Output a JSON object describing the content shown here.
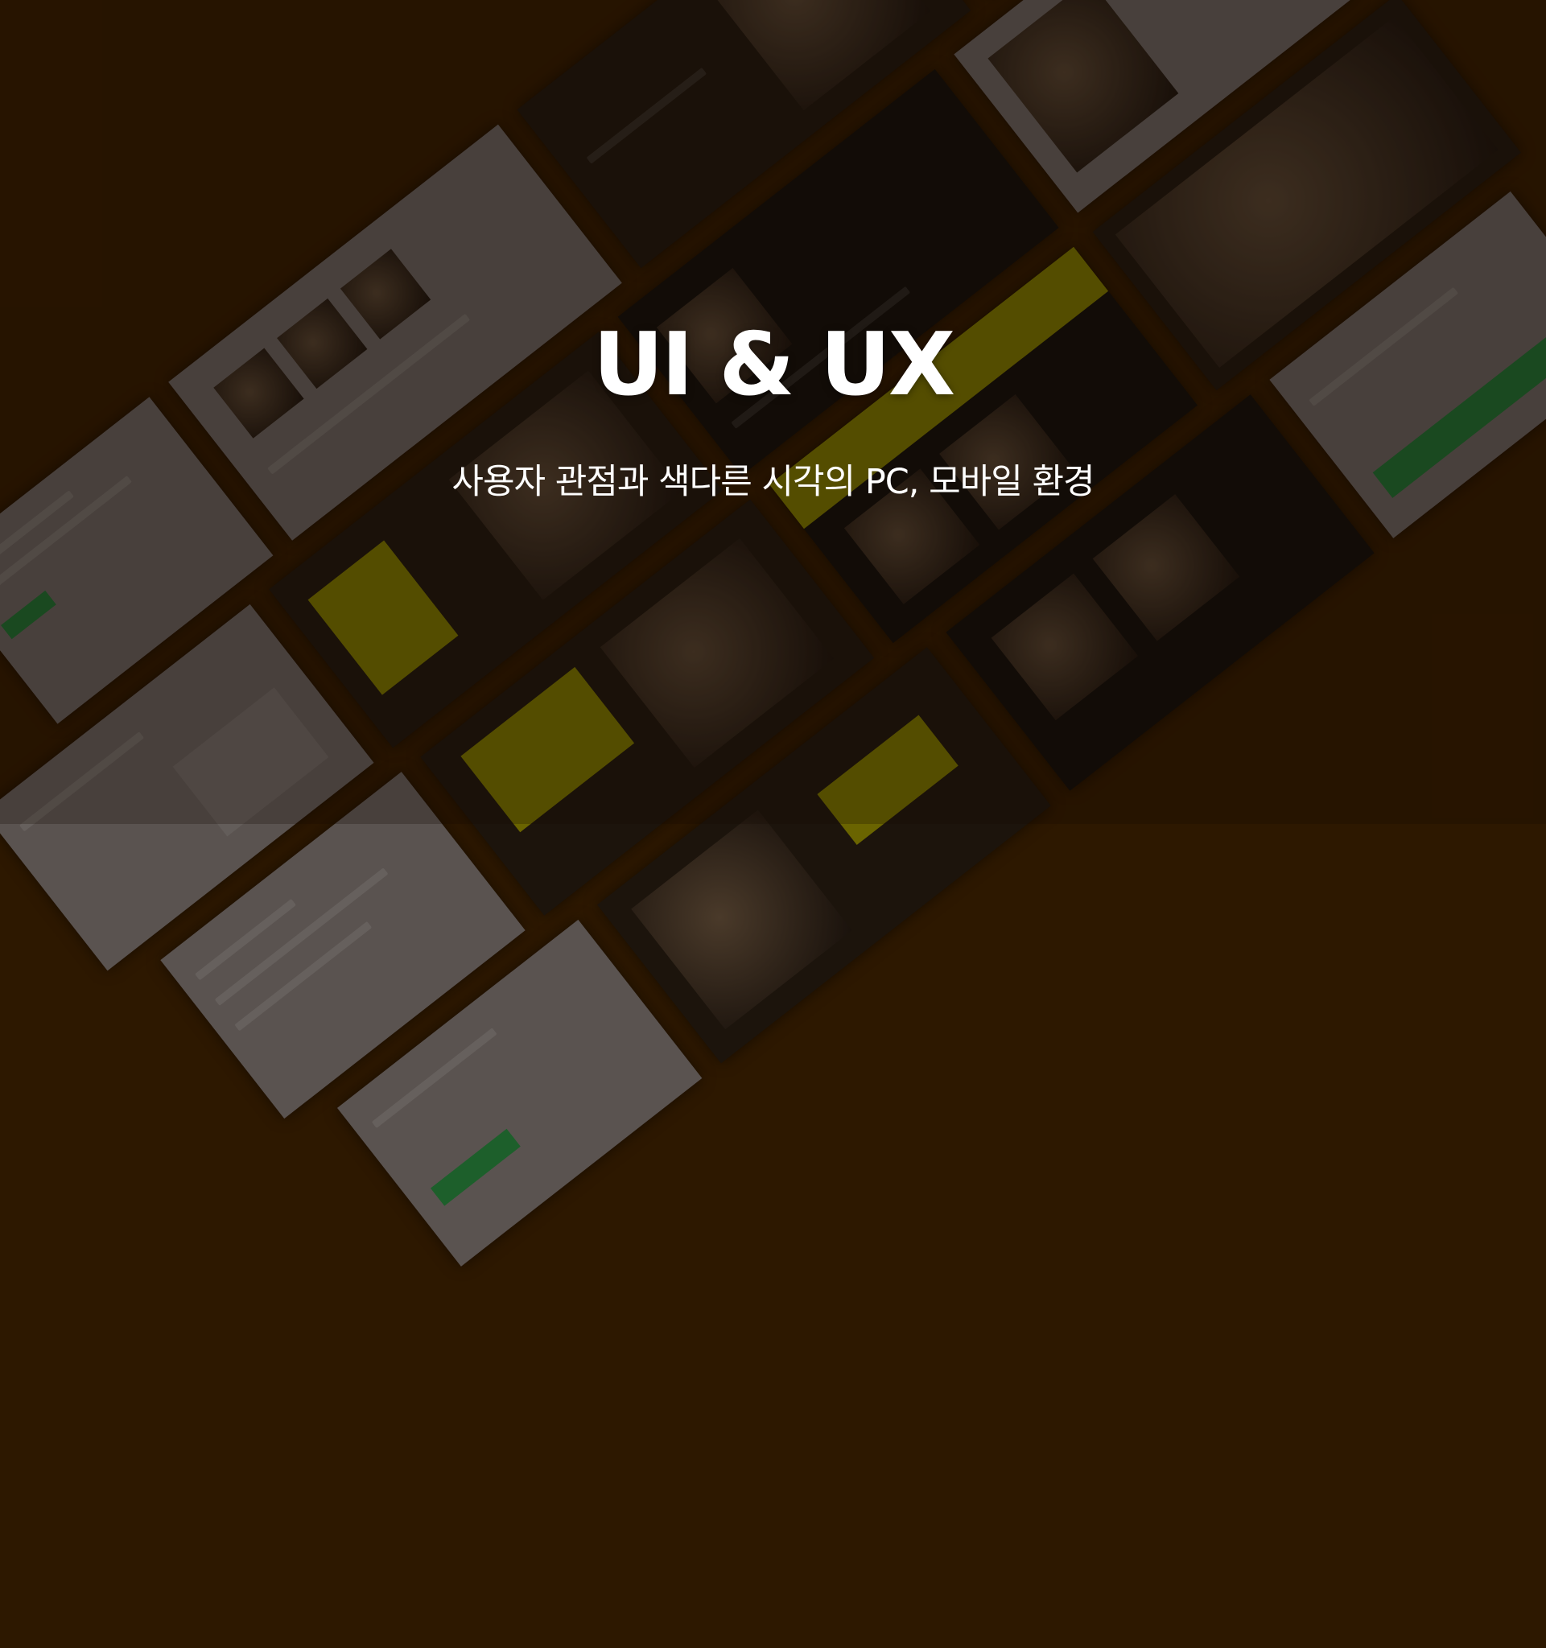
{
  "hero": {
    "title": "UI & UX",
    "subtitle": "사용자 관점과 색다른 시각의 PC, 모바일 환경"
  },
  "colors": {
    "background": "#2d1800",
    "text": "#ffffff",
    "accent_yellow": "#e6e000",
    "accent_green": "#2fb34a"
  }
}
